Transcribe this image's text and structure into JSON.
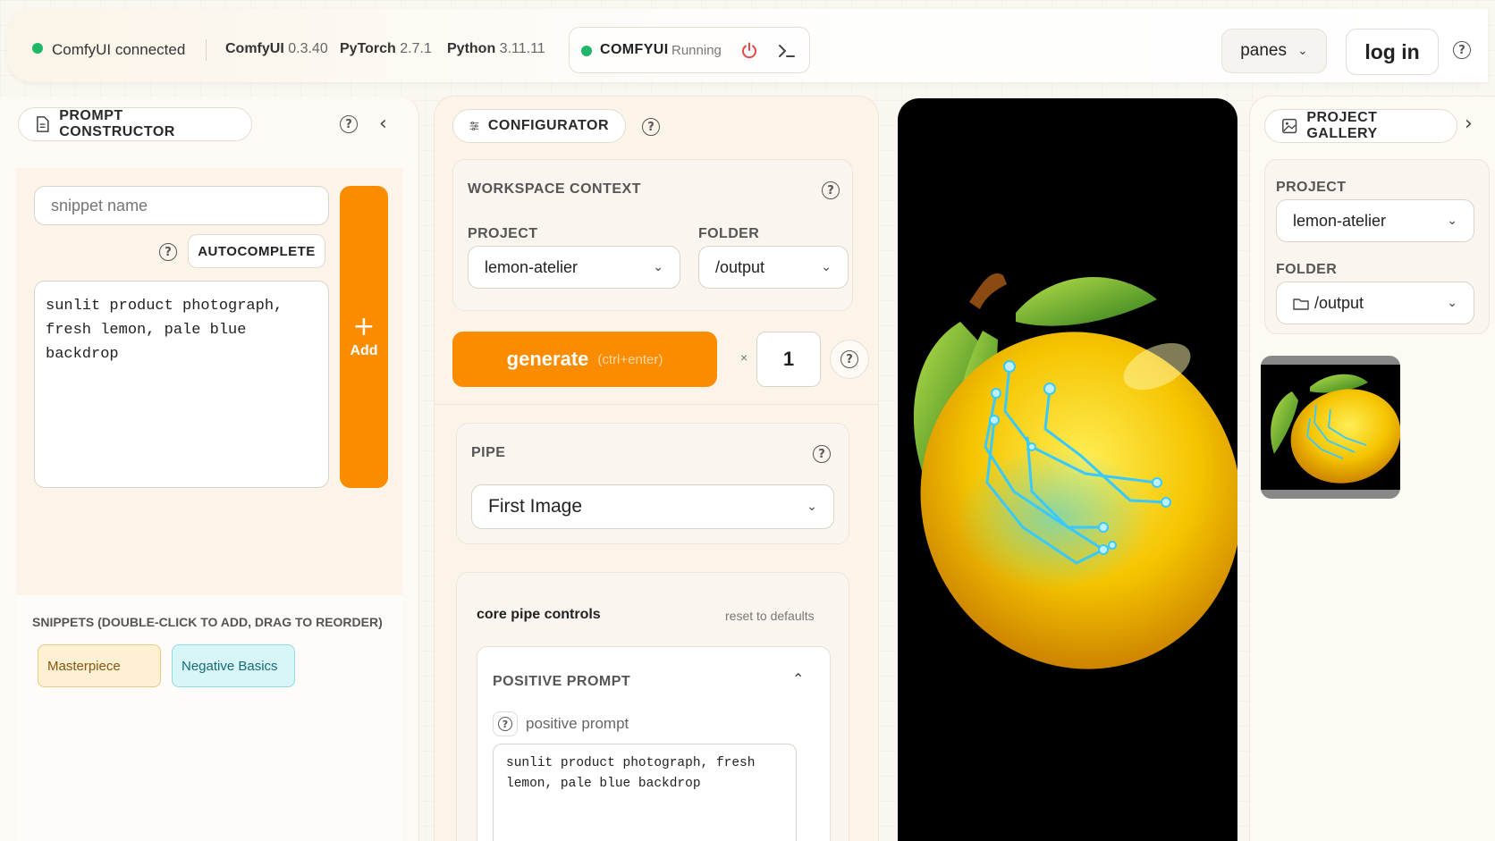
{
  "topbar": {
    "status": "ComfyUI connected",
    "versions": [
      {
        "name": "ComfyUI",
        "version": "0.3.40"
      },
      {
        "name": "PyTorch",
        "version": "2.7.1"
      },
      {
        "name": "Python",
        "version": "3.11.11"
      }
    ],
    "server_name": "COMFYUI",
    "server_state": "Running",
    "panes_label": "panes",
    "login_label": "log in",
    "colors": {
      "connected": "#1fb86a",
      "power": "#e04848",
      "accent": "#fb8c00"
    }
  },
  "prompt_constructor": {
    "title": "PROMPT CONSTRUCTOR",
    "snippet_placeholder": "snippet name",
    "autocomplete_label": "AUTOCOMPLETE",
    "prompt_text": "sunlit product photograph, fresh lemon, pale blue backdrop",
    "add_label": "Add",
    "snippets_heading": "SNIPPETS (DOUBLE-CLICK TO ADD, DRAG TO REORDER)",
    "snippets": [
      {
        "label": "Masterpiece",
        "color": "#fdf0d3"
      },
      {
        "label": "Negative Basics",
        "color": "#d8f6f8"
      }
    ]
  },
  "configurator": {
    "title": "CONFIGURATOR",
    "workspace_title": "WORKSPACE CONTEXT",
    "project_label": "PROJECT",
    "project_value": "lemon-atelier",
    "folder_label": "FOLDER",
    "folder_value": "/output",
    "generate_label": "generate",
    "generate_hint": "(ctrl+enter)",
    "multiplier": "×",
    "batch_count": "1",
    "pipe_title": "PIPE",
    "pipe_value": "First Image",
    "core_controls_title": "core pipe controls",
    "reset_label": "reset to defaults",
    "positive_title": "POSITIVE PROMPT",
    "positive_field_label": "positive prompt",
    "positive_text": "sunlit product photograph, fresh lemon, pale blue backdrop"
  },
  "gallery": {
    "title": "PROJECT GALLERY",
    "project_label": "PROJECT",
    "project_value": "lemon-atelier",
    "folder_label": "FOLDER",
    "folder_value": "/output"
  }
}
